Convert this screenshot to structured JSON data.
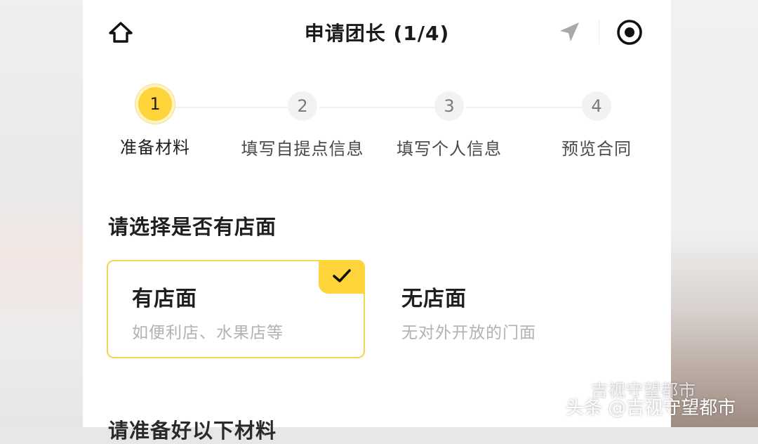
{
  "nav": {
    "title": "申请团长 (1/4)",
    "icons": [
      "home-icon",
      "location-arrow-icon",
      "target-icon"
    ]
  },
  "stepper": {
    "current_step": 1,
    "steps": [
      {
        "number": "1",
        "label": "准备材料"
      },
      {
        "number": "2",
        "label": "填写自提点信息"
      },
      {
        "number": "3",
        "label": "填写个人信息"
      },
      {
        "number": "4",
        "label": "预览合同"
      }
    ]
  },
  "store_choice": {
    "title": "请选择是否有店面",
    "options": [
      {
        "title": "有店面",
        "description": "如便利店、水果店等",
        "selected": true
      },
      {
        "title": "无店面",
        "description": "无对外开放的门面",
        "selected": false
      }
    ]
  },
  "next_section": {
    "title": "请准备好以下材料"
  },
  "watermark": {
    "ghost_text": "吉视守望都市",
    "main_text": "头条 @吉视守望都市"
  },
  "colors": {
    "accent": "#ffd43a",
    "selected_border": "#f5d54a",
    "text_primary": "#1f1f1f",
    "text_secondary": "#b2b2b2"
  }
}
